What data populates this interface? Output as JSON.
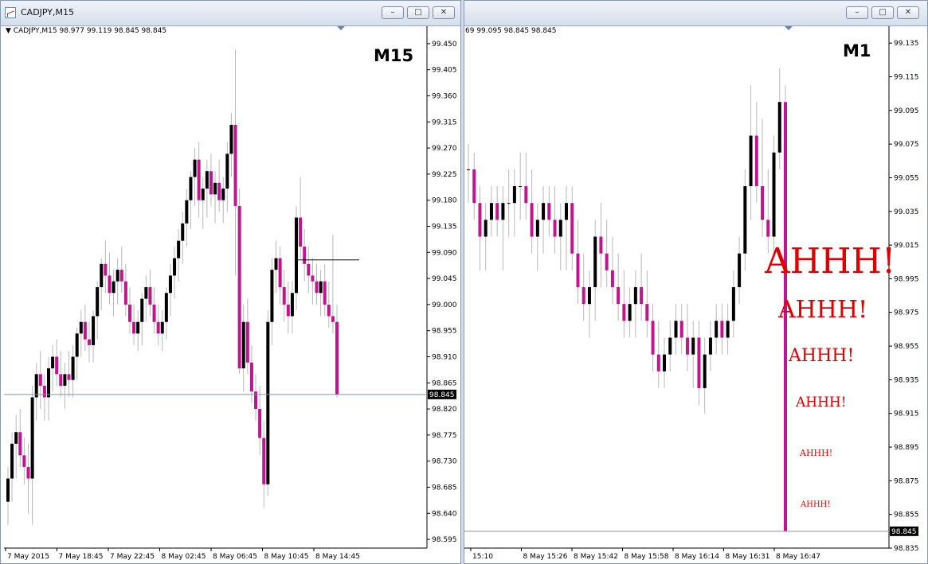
{
  "left_window": {
    "title": "CADJPY,M15",
    "header": "CADJPY,M15  98.977 99.119 98.845 98.845",
    "timeframe_label": "M15",
    "price_axis": [
      "99.450",
      "99.405",
      "99.360",
      "99.315",
      "99.270",
      "99.225",
      "99.180",
      "99.135",
      "99.090",
      "99.045",
      "99.000",
      "98.955",
      "98.910",
      "98.865",
      "98.820",
      "98.775",
      "98.730",
      "98.685",
      "98.640",
      "98.595"
    ],
    "current_price": "98.845",
    "time_axis": [
      "7 May 2015",
      "7 May 18:45",
      "7 May 22:45",
      "8 May 02:45",
      "8 May 06:45",
      "8 May 10:45",
      "8 May 14:45"
    ]
  },
  "right_window": {
    "header": "69 99.095 98.845 98.845",
    "timeframe_label": "M1",
    "price_axis": [
      "99.135",
      "99.115",
      "99.095",
      "99.075",
      "99.055",
      "99.035",
      "99.015",
      "98.995",
      "98.975",
      "98.955",
      "98.935",
      "98.915",
      "98.895",
      "98.875",
      "98.855",
      "98.835"
    ],
    "current_price": "98.845",
    "time_axis": [
      "15:10",
      "8 May 15:26",
      "8 May 15:42",
      "8 May 15:58",
      "8 May 16:14",
      "8 May 16:31",
      "8 May 16:47"
    ],
    "annotations": [
      "AHHH!",
      "AHHH!",
      "AHHH!",
      "AHHH!",
      "AHHH!",
      "AHHH!"
    ]
  },
  "colors": {
    "bull": "#000000",
    "bear": "#c0158f",
    "annotation": "#e00000",
    "grid_line": "#7f93b0"
  },
  "chart_data": [
    {
      "type": "candlestick",
      "title": "CADJPY,M15",
      "ylim": [
        98.58,
        99.48
      ],
      "candles": [
        [
          98.66,
          98.72,
          98.62,
          98.7
        ],
        [
          98.7,
          98.78,
          98.66,
          98.76
        ],
        [
          98.76,
          98.81,
          98.7,
          98.78
        ],
        [
          98.78,
          98.82,
          98.72,
          98.74
        ],
        [
          98.74,
          98.77,
          98.69,
          98.72
        ],
        [
          98.72,
          98.76,
          98.64,
          98.7
        ],
        [
          98.7,
          98.86,
          98.62,
          98.84
        ],
        [
          98.84,
          98.9,
          98.8,
          98.88
        ],
        [
          98.88,
          98.92,
          98.82,
          98.86
        ],
        [
          98.86,
          98.88,
          98.8,
          98.84
        ],
        [
          98.84,
          98.91,
          98.8,
          98.89
        ],
        [
          98.89,
          98.93,
          98.85,
          98.91
        ],
        [
          98.91,
          98.94,
          98.86,
          98.88
        ],
        [
          98.88,
          98.92,
          98.84,
          98.86
        ],
        [
          98.86,
          98.9,
          98.82,
          98.88
        ],
        [
          98.88,
          98.92,
          98.84,
          98.87
        ],
        [
          98.87,
          98.93,
          98.84,
          98.91
        ],
        [
          98.91,
          98.96,
          98.87,
          98.95
        ],
        [
          98.95,
          98.99,
          98.91,
          98.97
        ],
        [
          98.97,
          99.0,
          98.92,
          98.94
        ],
        [
          98.94,
          98.97,
          98.9,
          98.93
        ],
        [
          98.93,
          98.99,
          98.9,
          98.98
        ],
        [
          98.98,
          99.04,
          98.94,
          99.03
        ],
        [
          99.03,
          99.08,
          98.99,
          99.07
        ],
        [
          99.07,
          99.11,
          99.02,
          99.05
        ],
        [
          99.05,
          99.09,
          99.0,
          99.02
        ],
        [
          99.02,
          99.06,
          98.98,
          99.04
        ],
        [
          99.04,
          99.08,
          99.0,
          99.06
        ],
        [
          99.06,
          99.1,
          99.02,
          99.04
        ],
        [
          99.04,
          99.07,
          98.98,
          99.0
        ],
        [
          99.0,
          99.03,
          98.95,
          98.97
        ],
        [
          98.97,
          99.0,
          98.93,
          98.95
        ],
        [
          98.95,
          98.99,
          98.92,
          98.97
        ],
        [
          98.97,
          99.02,
          98.93,
          99.01
        ],
        [
          99.01,
          99.05,
          98.97,
          99.03
        ],
        [
          99.03,
          99.06,
          98.98,
          99.0
        ],
        [
          99.0,
          99.03,
          98.95,
          98.97
        ],
        [
          98.97,
          99.0,
          98.93,
          98.95
        ],
        [
          98.95,
          98.99,
          98.92,
          98.97
        ],
        [
          98.97,
          99.03,
          98.94,
          99.02
        ],
        [
          99.02,
          99.07,
          98.98,
          99.05
        ],
        [
          99.05,
          99.1,
          99.01,
          99.08
        ],
        [
          99.08,
          99.13,
          99.04,
          99.11
        ],
        [
          99.11,
          99.16,
          99.07,
          99.14
        ],
        [
          99.14,
          99.2,
          99.1,
          99.18
        ],
        [
          99.18,
          99.23,
          99.13,
          99.22
        ],
        [
          99.22,
          99.27,
          99.17,
          99.25
        ],
        [
          99.25,
          99.28,
          99.15,
          99.18
        ],
        [
          99.18,
          99.22,
          99.13,
          99.2
        ],
        [
          99.2,
          99.25,
          99.15,
          99.23
        ],
        [
          99.23,
          99.26,
          99.17,
          99.19
        ],
        [
          99.19,
          99.23,
          99.14,
          99.21
        ],
        [
          99.21,
          99.25,
          99.16,
          99.18
        ],
        [
          99.18,
          99.22,
          99.14,
          99.2
        ],
        [
          99.2,
          99.28,
          99.16,
          99.26
        ],
        [
          99.26,
          99.33,
          99.22,
          99.31
        ],
        [
          99.31,
          99.44,
          99.05,
          99.17
        ],
        [
          99.17,
          99.2,
          98.88,
          98.89
        ],
        [
          98.89,
          99.0,
          98.85,
          98.97
        ],
        [
          98.97,
          99.01,
          98.88,
          98.9
        ],
        [
          98.9,
          98.93,
          98.83,
          98.85
        ],
        [
          98.85,
          98.88,
          98.8,
          98.82
        ],
        [
          98.82,
          98.86,
          98.74,
          98.77
        ],
        [
          98.77,
          98.8,
          98.65,
          98.69
        ],
        [
          98.69,
          98.99,
          98.67,
          98.97
        ],
        [
          98.97,
          99.08,
          98.93,
          99.06
        ],
        [
          99.06,
          99.11,
          99.02,
          99.08
        ],
        [
          99.08,
          99.1,
          99.0,
          99.03
        ],
        [
          99.03,
          99.06,
          98.97,
          99.0
        ],
        [
          99.0,
          99.04,
          98.95,
          98.98
        ],
        [
          98.98,
          99.04,
          98.95,
          99.02
        ],
        [
          99.02,
          99.17,
          98.99,
          99.15
        ],
        [
          99.15,
          99.22,
          99.08,
          99.1
        ],
        [
          99.1,
          99.13,
          99.04,
          99.07
        ],
        [
          99.07,
          99.1,
          99.02,
          99.05
        ],
        [
          99.05,
          99.08,
          99.0,
          99.04
        ],
        [
          99.04,
          99.07,
          99.0,
          99.02
        ],
        [
          99.02,
          99.06,
          98.98,
          99.04
        ],
        [
          99.04,
          99.07,
          98.98,
          99.0
        ],
        [
          99.0,
          99.04,
          98.96,
          98.98
        ],
        [
          98.98,
          99.12,
          98.95,
          98.97
        ],
        [
          98.97,
          99.0,
          98.84,
          98.845
        ]
      ]
    },
    {
      "type": "candlestick",
      "title": "M1",
      "ylim": [
        98.835,
        99.145
      ],
      "candles": [
        [
          99.06,
          99.075,
          99.04,
          99.06
        ],
        [
          99.06,
          99.07,
          99.03,
          99.04
        ],
        [
          99.04,
          99.05,
          99.0,
          99.02
        ],
        [
          99.02,
          99.04,
          99.0,
          99.03
        ],
        [
          99.03,
          99.05,
          99.02,
          99.04
        ],
        [
          99.04,
          99.05,
          99.02,
          99.03
        ],
        [
          99.03,
          99.05,
          99.0,
          99.04
        ],
        [
          99.04,
          99.06,
          99.02,
          99.04
        ],
        [
          99.04,
          99.06,
          99.02,
          99.05
        ],
        [
          99.05,
          99.07,
          99.03,
          99.05
        ],
        [
          99.05,
          99.07,
          99.03,
          99.04
        ],
        [
          99.04,
          99.06,
          99.01,
          99.02
        ],
        [
          99.02,
          99.04,
          99.0,
          99.03
        ],
        [
          99.03,
          99.05,
          99.01,
          99.04
        ],
        [
          99.04,
          99.05,
          99.02,
          99.03
        ],
        [
          99.03,
          99.05,
          99.01,
          99.02
        ],
        [
          99.02,
          99.04,
          99.0,
          99.03
        ],
        [
          99.03,
          99.05,
          99.0,
          99.04
        ],
        [
          99.04,
          99.05,
          99.0,
          99.01
        ],
        [
          99.01,
          99.03,
          98.98,
          98.99
        ],
        [
          98.99,
          99.01,
          98.97,
          98.98
        ],
        [
          98.98,
          99.0,
          98.96,
          98.99
        ],
        [
          98.99,
          99.03,
          98.97,
          99.02
        ],
        [
          99.02,
          99.04,
          98.99,
          99.01
        ],
        [
          99.01,
          99.03,
          98.99,
          99.0
        ],
        [
          99.0,
          99.02,
          98.98,
          98.99
        ],
        [
          98.99,
          99.01,
          98.97,
          98.98
        ],
        [
          98.98,
          99.0,
          98.96,
          98.97
        ],
        [
          98.97,
          98.99,
          98.96,
          98.98
        ],
        [
          98.98,
          99.0,
          98.96,
          98.99
        ],
        [
          98.99,
          99.01,
          98.97,
          98.98
        ],
        [
          98.98,
          99.0,
          98.96,
          98.97
        ],
        [
          98.97,
          98.98,
          98.94,
          98.95
        ],
        [
          98.95,
          98.97,
          98.93,
          98.94
        ],
        [
          98.94,
          98.96,
          98.93,
          98.95
        ],
        [
          98.95,
          98.97,
          98.94,
          98.96
        ],
        [
          98.96,
          98.98,
          98.95,
          98.97
        ],
        [
          98.97,
          98.98,
          98.95,
          98.96
        ],
        [
          98.96,
          98.98,
          98.94,
          98.95
        ],
        [
          98.95,
          98.97,
          98.93,
          98.96
        ],
        [
          98.96,
          98.97,
          98.92,
          98.93
        ],
        [
          98.93,
          98.96,
          98.915,
          98.95
        ],
        [
          98.95,
          98.97,
          98.94,
          98.96
        ],
        [
          98.96,
          98.98,
          98.95,
          98.97
        ],
        [
          98.97,
          98.98,
          98.95,
          98.96
        ],
        [
          98.96,
          98.98,
          98.95,
          98.97
        ],
        [
          98.97,
          99.0,
          98.96,
          98.99
        ],
        [
          98.99,
          99.02,
          98.98,
          99.01
        ],
        [
          99.01,
          99.06,
          99.0,
          99.05
        ],
        [
          99.05,
          99.11,
          99.03,
          99.08
        ],
        [
          99.08,
          99.1,
          99.04,
          99.05
        ],
        [
          99.05,
          99.09,
          99.02,
          99.03
        ],
        [
          99.03,
          99.06,
          99.01,
          99.02
        ],
        [
          99.02,
          99.08,
          99.01,
          99.07
        ],
        [
          99.07,
          99.12,
          99.06,
          99.1
        ],
        [
          99.1,
          99.11,
          98.845,
          98.845
        ]
      ]
    }
  ]
}
